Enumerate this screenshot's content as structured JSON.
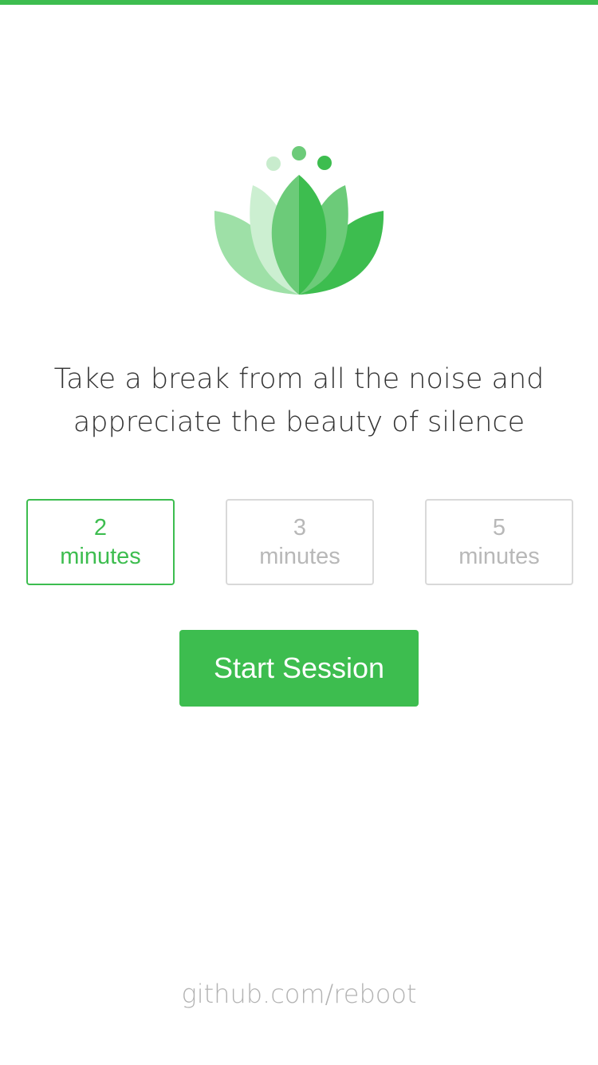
{
  "brand": {
    "accent_color": "#3dbd4f",
    "logo_icon": "lotus-icon"
  },
  "tagline": {
    "line1": "Take a break from all the noise and",
    "line2": "appreciate the beauty of silence"
  },
  "durations": [
    {
      "value": "2",
      "unit": "minutes",
      "selected": true
    },
    {
      "value": "3",
      "unit": "minutes",
      "selected": false
    },
    {
      "value": "5",
      "unit": "minutes",
      "selected": false
    }
  ],
  "start_button": {
    "label": "Start Session"
  },
  "footer": {
    "link": "github.com/reboot"
  }
}
